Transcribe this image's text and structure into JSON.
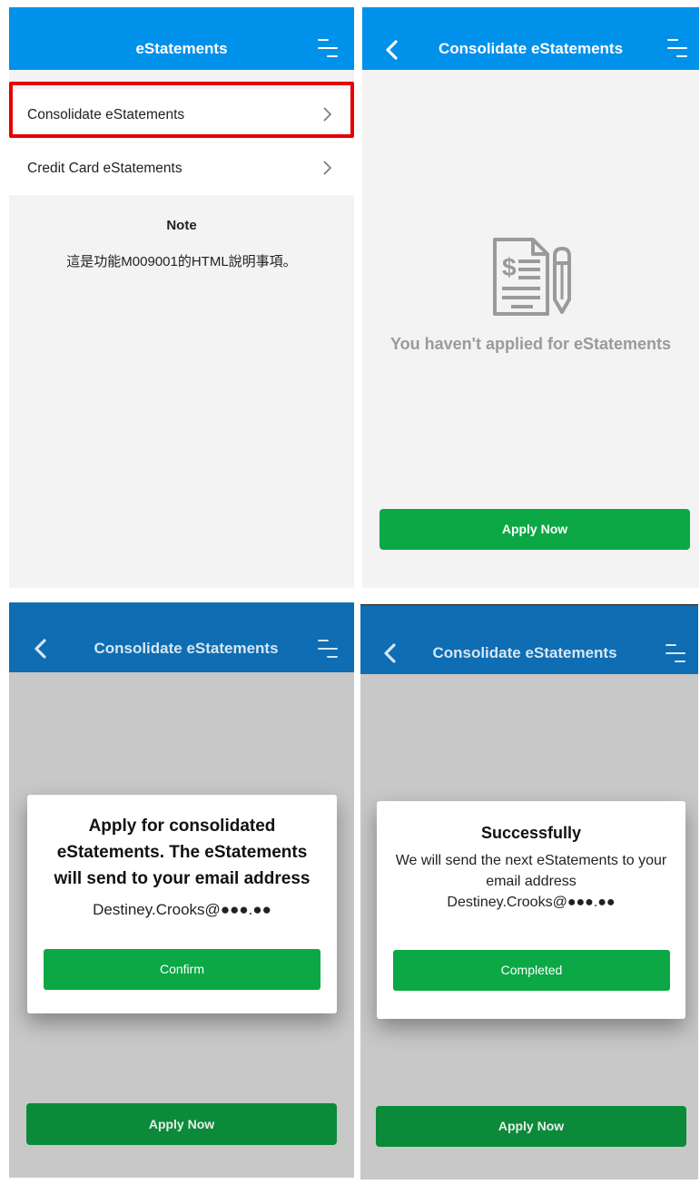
{
  "screen1": {
    "header": {
      "title": "eStatements"
    },
    "menu_items": [
      {
        "label": "Consolidate eStatements"
      },
      {
        "label": "Credit Card eStatements"
      }
    ],
    "note": {
      "title": "Note",
      "body": "這是功能M009001的HTML說明事項。"
    },
    "highlight_color": "#e60000"
  },
  "screen2": {
    "header": {
      "title": "Consolidate eStatements"
    },
    "empty_state": {
      "icon": "statement-document-icon",
      "message": "You haven't applied for eStatements"
    },
    "apply_button": {
      "label": "Apply Now"
    }
  },
  "screen3": {
    "header": {
      "title": "Consolidate eStatements"
    },
    "dialog": {
      "title": "Apply for consolidated eStatements. The eStatements will send to your email address",
      "email": "Destiney.Crooks@●●●.●●",
      "confirm_label": "Confirm"
    },
    "apply_button": {
      "label": "Apply Now"
    }
  },
  "screen4": {
    "header": {
      "title": "Consolidate eStatements"
    },
    "dialog": {
      "title": "Successfully",
      "message": "We will send the next eStatements to your email address",
      "email": "Destiney.Crooks@●●●.●●",
      "completed_label": "Completed"
    },
    "apply_button": {
      "label": "Apply Now"
    }
  },
  "colors": {
    "header_blue": "#0091ea",
    "header_blue_dimmed": "#0e6db3",
    "primary_green": "#0ba845",
    "empty_state_gray": "#9a9a9a"
  }
}
